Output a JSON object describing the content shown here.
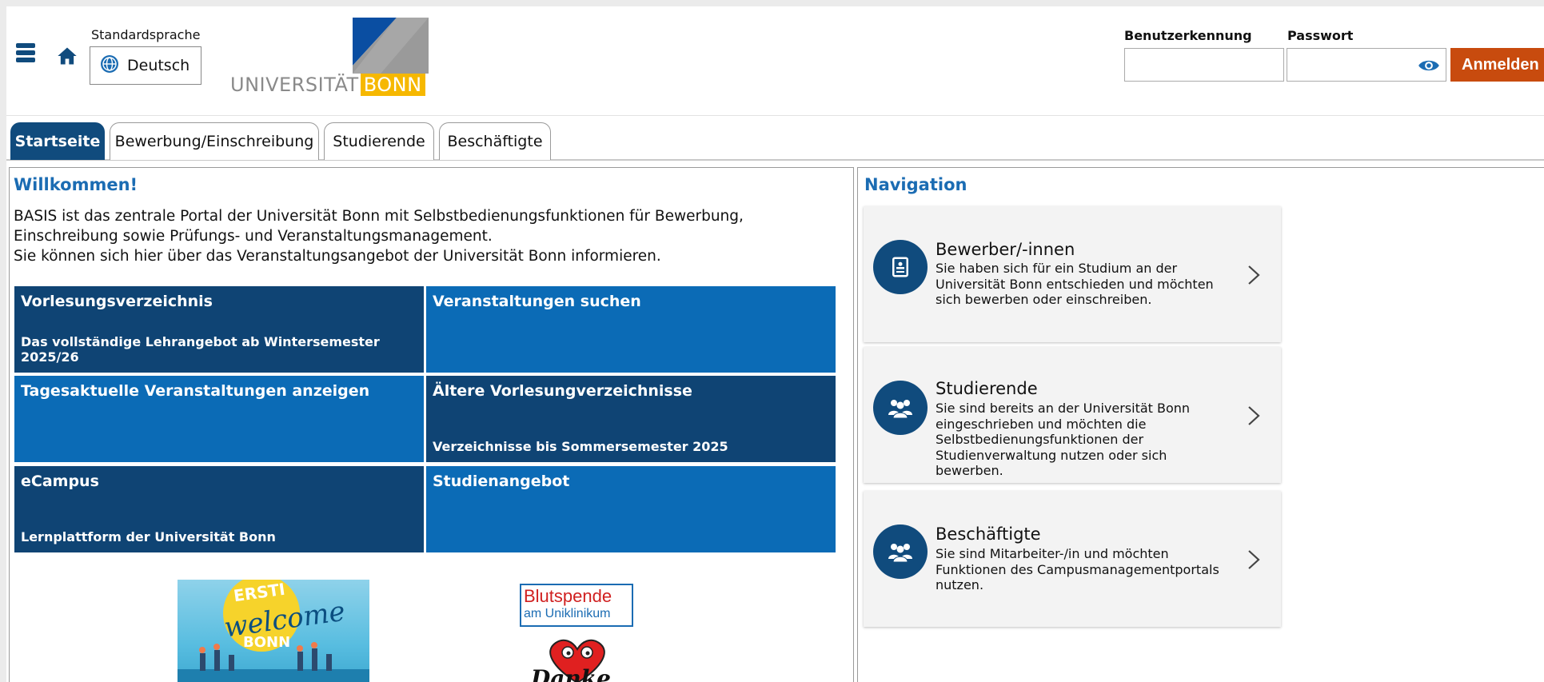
{
  "header": {
    "language_label": "Standardsprache",
    "language_value": "Deutsch",
    "logo_text_left": "UNIVERSITÄT",
    "logo_text_right": "BONN",
    "username_label": "Benutzerkennung",
    "password_label": "Passwort",
    "username_value": "",
    "password_value": "",
    "login_button": "Anmelden",
    "icons": {
      "menu": "hamburger-menu-icon",
      "home": "home-icon",
      "language": "globe-icon",
      "show_password": "eye-icon"
    }
  },
  "tabs": [
    {
      "label": "Startseite",
      "active": true
    },
    {
      "label": "Bewerbung/Einschreibung",
      "active": false
    },
    {
      "label": "Studierende",
      "active": false
    },
    {
      "label": "Beschäftigte",
      "active": false
    }
  ],
  "welcome": {
    "title": "Willkommen!",
    "paragraph_1": "BASIS ist das zentrale Portal der Universität Bonn mit Selbstbedienungsfunktionen für Bewerbung, Einschreibung sowie Prüfungs- und Veranstaltungsmanagement.",
    "paragraph_2": "Sie können sich hier über das Veranstaltungsangebot der Universität Bonn informieren."
  },
  "tiles": [
    {
      "title": "Vorlesungsverzeichnis",
      "subtitle": "Das vollständige Lehrangebot ab Wintersemester 2025/26"
    },
    {
      "title": "Veranstaltungen suchen",
      "subtitle": ""
    },
    {
      "title": "Tagesaktuelle Veranstaltungen anzeigen",
      "subtitle": ""
    },
    {
      "title": "Ältere Vorlesungverzeichnisse",
      "subtitle": "Verzeichnisse bis Sommersemester 2025"
    },
    {
      "title": "eCampus",
      "subtitle": "Lernplattform der Universität Bonn"
    },
    {
      "title": "Studienangebot",
      "subtitle": ""
    }
  ],
  "banners": {
    "ersti": {
      "line1": "ERSTI",
      "line2": "welcome",
      "line3": "BONN"
    },
    "blutspende": {
      "line1": "Blutspende",
      "line2": "am Uniklinikum",
      "line3": "Danke"
    }
  },
  "navigation": {
    "title": "Navigation",
    "cards": [
      {
        "title": "Bewerber/-innen",
        "description": "Sie haben sich für ein Studium an der Universität Bonn entschieden und möchten sich bewerben oder einschreiben.",
        "icon": "document-icon"
      },
      {
        "title": "Studierende",
        "description": "Sie sind bereits an der Universität Bonn eingeschrieben und möchten die Selbstbedienungsfunktionen der Studienverwaltung nutzen oder sich bewerben.",
        "icon": "group-icon"
      },
      {
        "title": "Beschäftigte",
        "description": "Sie sind Mitarbeiter-/in und möchten Funktionen des Campusmanagementportals nutzen.",
        "icon": "group-icon"
      }
    ]
  },
  "colors": {
    "primary_dark": "#104b7d",
    "tile_dark": "#0f4474",
    "tile_blue": "#0b6bb6",
    "heading_blue": "#1b6cb3",
    "login_orange": "#c84b0e",
    "logo_yellow": "#f6b800"
  }
}
